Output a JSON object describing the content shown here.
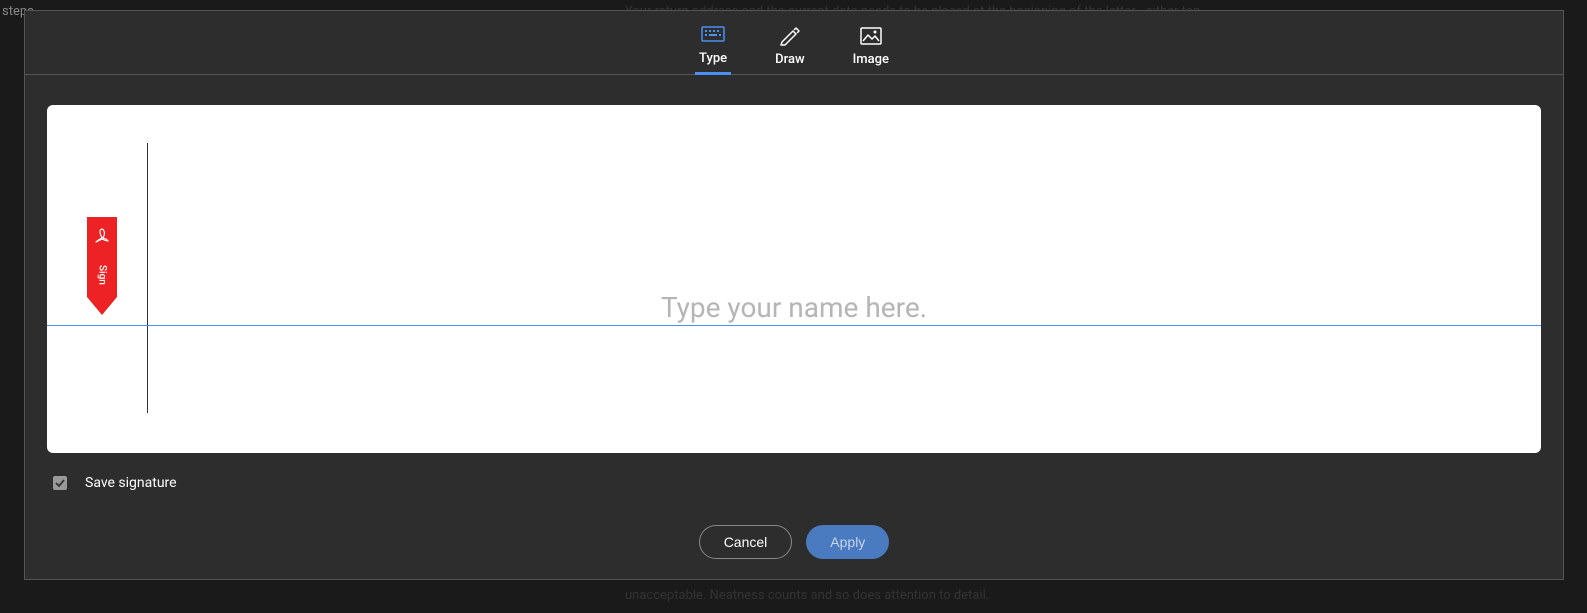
{
  "background": {
    "steps": "steps",
    "top_text": "Your return address and the current date needs to be placed at the beginning of the letter - either top",
    "bottom_text": "unacceptable.  Neatness counts and so does attention to detail."
  },
  "tabs": {
    "type": "Type",
    "draw": "Draw",
    "image": "Image"
  },
  "signature": {
    "marker_label": "Sign",
    "placeholder": "Type your name here."
  },
  "controls": {
    "save_label": "Save signature",
    "cancel_label": "Cancel",
    "apply_label": "Apply"
  }
}
